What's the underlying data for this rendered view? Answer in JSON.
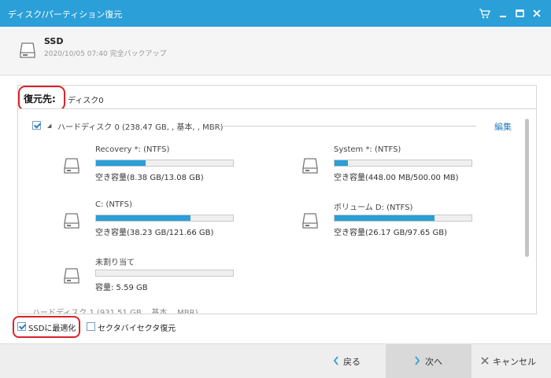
{
  "window": {
    "title": "ディスク/パーティション復元",
    "controls": [
      "cart-icon",
      "minimize-icon",
      "maximize-icon",
      "close-icon"
    ]
  },
  "source": {
    "name": "SSD",
    "subtitle": "2020/10/05 07:40 完全バックアップ"
  },
  "destination": {
    "label": "復元先:",
    "value": "ディスク0"
  },
  "disk0": {
    "label": "ハードディスク 0 (238.47 GB, , 基本, , MBR)",
    "checked": true,
    "edit_label": "編集"
  },
  "partitions": [
    {
      "name": "Recovery *: (NTFS)",
      "capacity": "空き容量(8.38 GB/13.08 GB)",
      "used_fraction": 0.36
    },
    {
      "name": "System *: (NTFS)",
      "capacity": "空き容量(448.00 MB/500.00 MB)",
      "used_fraction": 0.1
    },
    {
      "name": "C: (NTFS)",
      "capacity": "空き容量(38.23 GB/121.66 GB)",
      "used_fraction": 0.69
    },
    {
      "name": "ボリューム D: (NTFS)",
      "capacity": "空き容量(26.17 GB/97.65 GB)",
      "used_fraction": 0.73
    },
    {
      "name": "未割り当て",
      "capacity": "容量: 5.59 GB",
      "used_fraction": 0
    }
  ],
  "disk1": {
    "label": "ハードディスク 1 (931.51 GB, , 基本, , MBR)"
  },
  "options": {
    "optimize_ssd": {
      "label": "SSDに最適化",
      "checked": true
    },
    "sector_by_sector": {
      "label": "セクタバイセクタ復元",
      "checked": false
    }
  },
  "buttons": {
    "back": "戻る",
    "next": "次へ",
    "cancel": "キャンセル"
  },
  "colors": {
    "accent": "#2a9fd8",
    "highlight": "#d8232a"
  }
}
